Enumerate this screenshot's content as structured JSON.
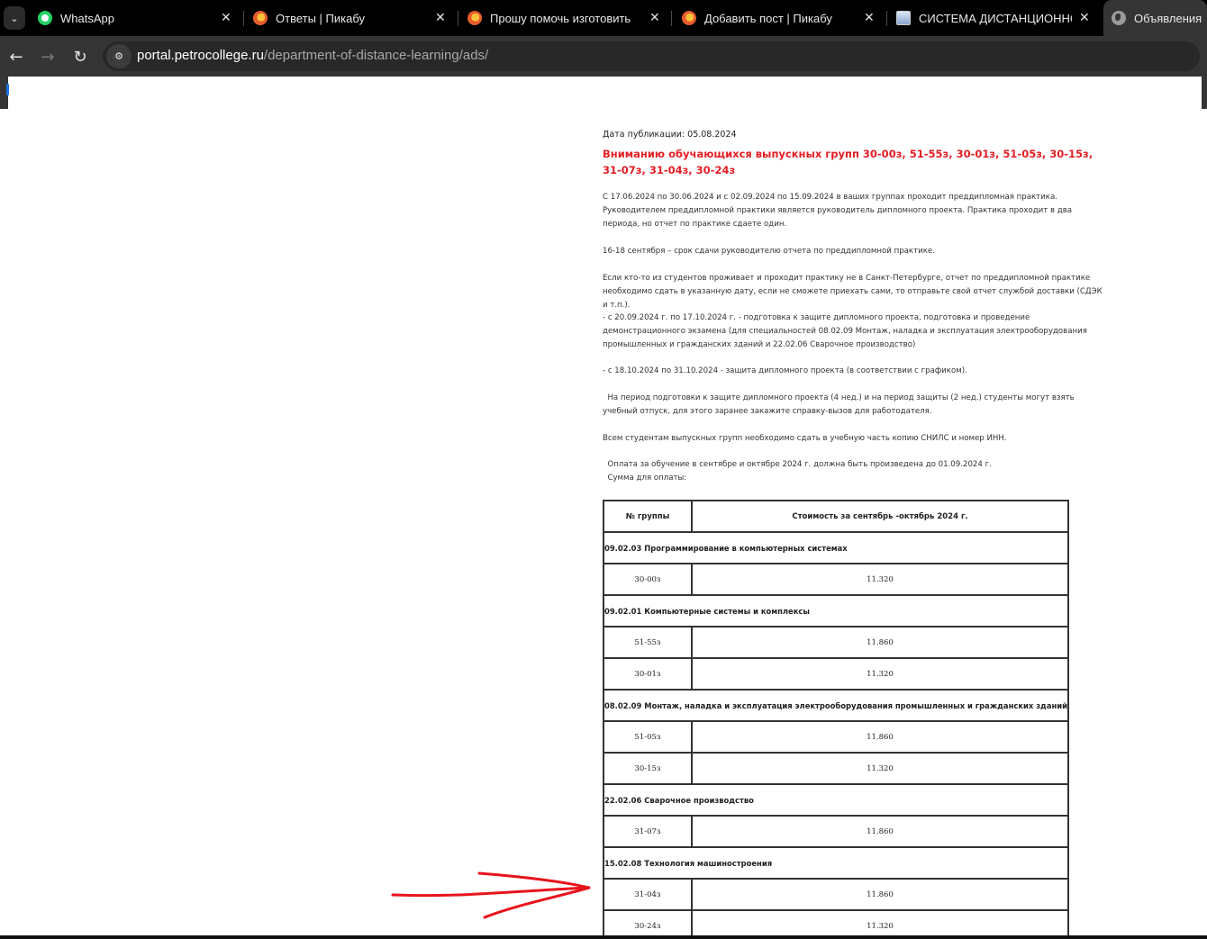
{
  "browser": {
    "tabs": [
      {
        "title": "WhatsApp",
        "icon": "whatsapp-icon",
        "active": false
      },
      {
        "title": "Ответы | Пикабу",
        "icon": "pikabu-icon",
        "active": false
      },
      {
        "title": "Прошу помочь изготовить дет",
        "icon": "pikabu-icon",
        "active": false
      },
      {
        "title": "Добавить пост | Пикабу",
        "icon": "pikabu-icon",
        "active": false
      },
      {
        "title": "СИСТЕМА ДИСТАНЦИОННОГО",
        "icon": "college-icon",
        "active": false
      },
      {
        "title": "Объявления",
        "icon": "globe-icon",
        "active": true
      }
    ],
    "close_glyph": "✕",
    "tab_menu_glyph": "⌄",
    "nav": {
      "back": "←",
      "forward": "→",
      "reload": "↻",
      "site_info": "⚙"
    },
    "url": {
      "host": "portal.petrocollege.ru",
      "path": "/department-of-distance-learning/ads/"
    }
  },
  "article": {
    "pub_date": "Дата публикации: 05.08.2024",
    "headline": "Вниманию обучающихся выпускных групп 30-00з, 51-55з, 30-01з, 51-05з, 30-15з, 31-07з, 31-04з, 30-24з",
    "paragraphs": [
      "С 17.06.2024 по 30.06.2024 и с 02.09.2024 по 15.09.2024 в ваших группах проходит преддипломная практика. Руководителем преддипломной практики является руководитель дипломного проекта. Практика проходит в два периода, но отчет по практике сдаете один.",
      "16-18 сентября – срок сдачи руководителю отчета по преддипломной практике.",
      "Если кто-то из студентов проживает и проходит практику не в Санкт-Петербурге, отчет по преддипломной практике необходимо сдать в указанную дату, если не сможете приехать сами, то отправьте свой отчет службой доставки (СДЭК и т.п.).",
      "- с 20.09.2024 г. по 17.10.2024 г. - подготовка к защите дипломного проекта, подготовка и проведение демонстрационного экзамена (для специальностей 08.02.09 Монтаж, наладка и эксплуатация электрооборудования промышленных и гражданских зданий и 22.02.06 Сварочное производство)",
      "- с 18.10.2024 по 31.10.2024 - защита дипломного проекта (в соответствии с графиком).",
      "  На период подготовки к защите дипломного проекта (4 нед.) и на период защиты (2 нед.) студенты могут взять учебный отпуск, для этого заранее закажите справку-вызов для работодателя.",
      "Всем студентам выпускных групп необходимо сдать в учебную часть копию СНИЛС и номер ИНН.",
      "  Оплата за обучение в сентябре и октябре 2024 г. должна быть произведена до 01.09.2024 г.",
      "  Сумма для оплаты:"
    ]
  },
  "fee_table": {
    "headers": [
      "№ группы",
      "Стоимость за сентябрь -октябрь 2024 г."
    ],
    "sections": [
      {
        "specialty": "09.02.03 Программирование в компьютерных системах",
        "rows": [
          {
            "group": "30-00з",
            "price": "11.320"
          }
        ]
      },
      {
        "specialty": "09.02.01 Компьютерные системы и комплексы",
        "rows": [
          {
            "group": "51-55з",
            "price": "11.860"
          },
          {
            "group": "30-01з",
            "price": "11.320"
          }
        ]
      },
      {
        "specialty": "08.02.09 Монтаж, наладка и эксплуатация электрооборудования промышленных и гражданских зданий",
        "rows": [
          {
            "group": "51-05з",
            "price": "11.860"
          },
          {
            "group": "30-15з",
            "price": "11.320"
          }
        ]
      },
      {
        "specialty": "22.02.06 Сварочное производство",
        "rows": [
          {
            "group": "31-07з",
            "price": "11.860"
          }
        ]
      },
      {
        "specialty": "15.02.08 Технология машиностроения",
        "rows": [
          {
            "group": "31-04з",
            "price": "11.860"
          },
          {
            "group": "30-24з",
            "price": "11.320"
          }
        ]
      }
    ]
  },
  "annotation": {
    "type": "hand-drawn-arrow",
    "color": "#e8141c",
    "points_to_group": "31-04з"
  },
  "colors": {
    "headline": "#e31e24",
    "tabstrip": "#000000",
    "toolbar": "#353535"
  }
}
